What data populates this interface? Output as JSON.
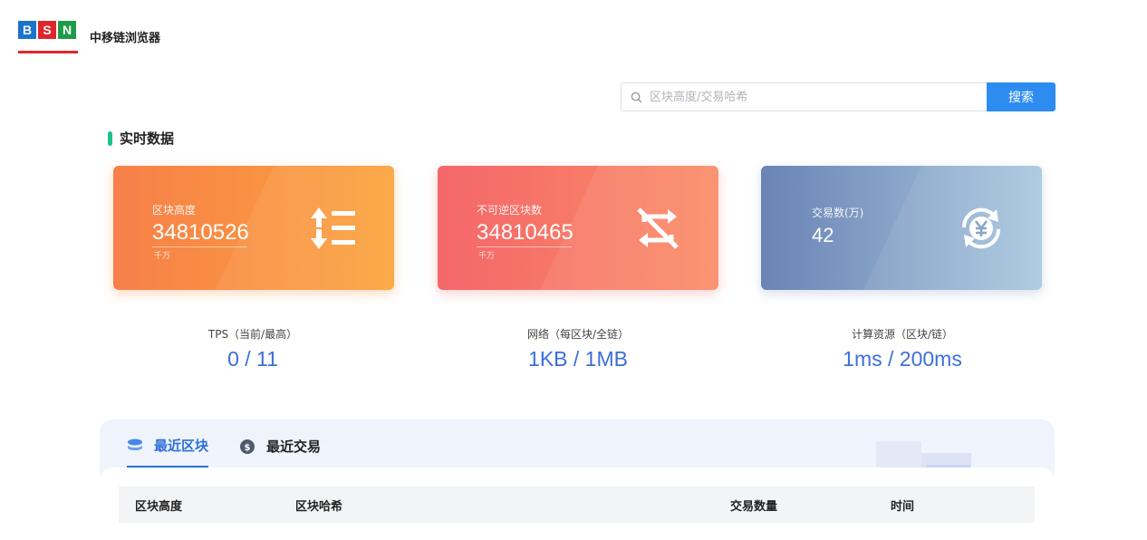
{
  "header": {
    "logo_letters": [
      "B",
      "S",
      "N"
    ],
    "title": "中移链浏览器"
  },
  "search": {
    "placeholder": "区块高度/交易哈希",
    "button_label": "搜索"
  },
  "section": {
    "title": "实时数据"
  },
  "cards": [
    {
      "label": "区块高度",
      "value": "34810526",
      "unit": "千万",
      "icon": "sort-list-icon"
    },
    {
      "label": "不可逆区块数",
      "value": "34810465",
      "unit": "千万",
      "icon": "repeat-off-icon"
    },
    {
      "label": "交易数(万)",
      "value": "42",
      "unit": "",
      "icon": "yuan-exchange-icon"
    }
  ],
  "metrics": [
    {
      "label": "TPS（当前/最高）",
      "value": "0 / 11"
    },
    {
      "label": "网络（每区块/全链）",
      "value": "1KB / 1MB"
    },
    {
      "label": "计算资源（区块/链）",
      "value": "1ms / 200ms"
    }
  ],
  "tabs": [
    {
      "label": "最近区块",
      "active": true,
      "icon": "database-icon"
    },
    {
      "label": "最近交易",
      "active": false,
      "icon": "coin-icon"
    }
  ],
  "table": {
    "headers": [
      "区块高度",
      "区块哈希",
      "交易数量",
      "时间"
    ]
  },
  "colors": {
    "accent": "#2d8cf0",
    "section_bar": "#1ec28b",
    "metric_value": "#3b6fd8"
  }
}
